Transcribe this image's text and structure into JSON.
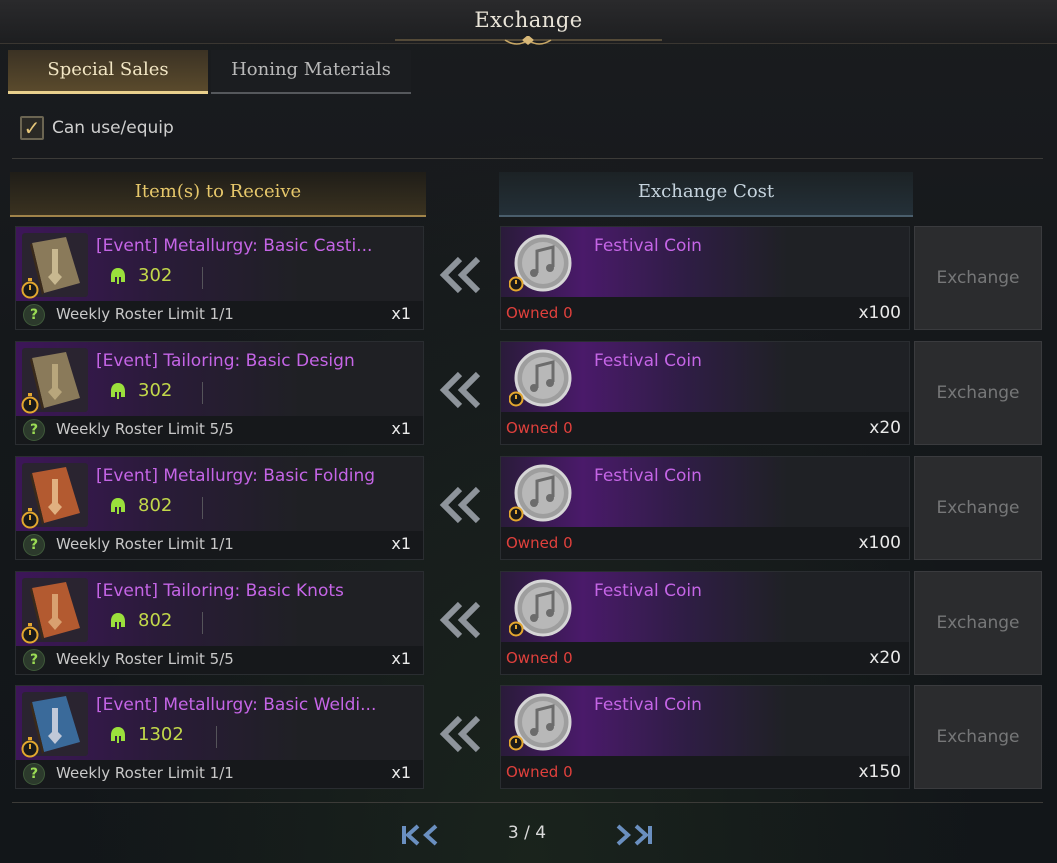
{
  "window": {
    "title": "Exchange"
  },
  "tabs": [
    {
      "label": "Special Sales",
      "active": true
    },
    {
      "label": "Honing Materials",
      "active": false
    }
  ],
  "filter": {
    "label": "Can use/equip",
    "checked": true
  },
  "columns": {
    "receive": "Item(s) to Receive",
    "cost": "Exchange Cost"
  },
  "rows": [
    {
      "item_name": "[Event] Metallurgy: Basic Casti...",
      "item_level": "302",
      "limit": "Weekly Roster Limit 1/1",
      "qty": "x1",
      "icon_color": "brown-book-sword",
      "cost_name": "Festival Coin",
      "owned": "Owned 0",
      "cost_qty": "x100",
      "button": "Exchange"
    },
    {
      "item_name": "[Event] Tailoring: Basic Design",
      "item_level": "302",
      "limit": "Weekly Roster Limit 5/5",
      "qty": "x1",
      "icon_color": "brown-book-armor",
      "cost_name": "Festival Coin",
      "owned": "Owned 0",
      "cost_qty": "x20",
      "button": "Exchange"
    },
    {
      "item_name": "[Event] Metallurgy: Basic Folding",
      "item_level": "802",
      "limit": "Weekly Roster Limit 1/1",
      "qty": "x1",
      "icon_color": "orange-book-sword",
      "cost_name": "Festival Coin",
      "owned": "Owned 0",
      "cost_qty": "x100",
      "button": "Exchange"
    },
    {
      "item_name": "[Event] Tailoring: Basic Knots",
      "item_level": "802",
      "limit": "Weekly Roster Limit 5/5",
      "qty": "x1",
      "icon_color": "orange-book-armor",
      "cost_name": "Festival Coin",
      "owned": "Owned 0",
      "cost_qty": "x20",
      "button": "Exchange"
    },
    {
      "item_name": "[Event] Metallurgy: Basic Weldi...",
      "item_level": "1302",
      "limit": "Weekly Roster Limit 1/1",
      "qty": "x1",
      "icon_color": "blue-book-sword",
      "cost_name": "Festival Coin",
      "owned": "Owned 0",
      "cost_qty": "x150",
      "button": "Exchange"
    }
  ],
  "pagination": {
    "text": "3 / 4"
  },
  "colors": {
    "item_purple": "#c565e6",
    "level_green": "#c2d84a",
    "owned_red": "#e0403c",
    "gold": "#e7c86b"
  }
}
